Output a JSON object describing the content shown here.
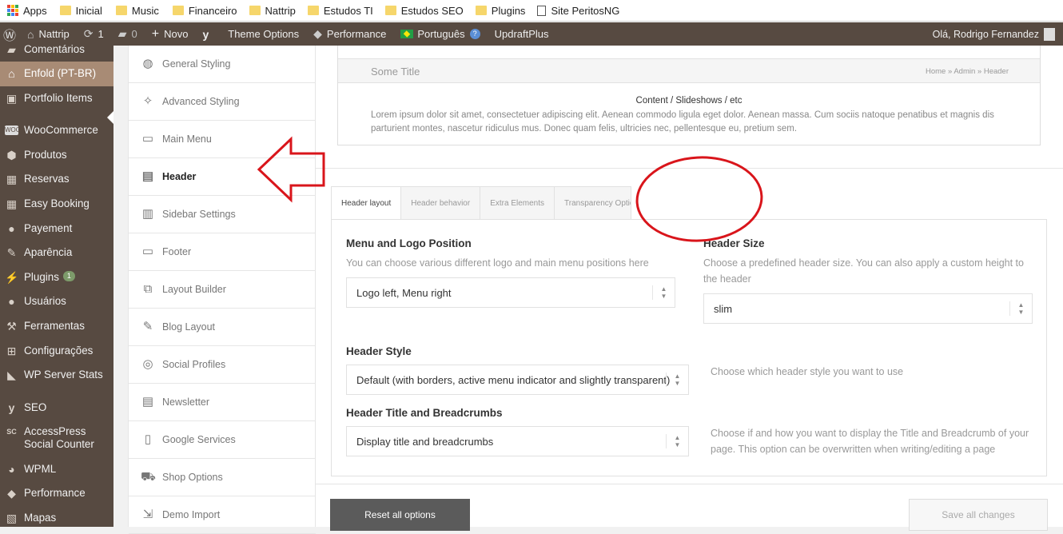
{
  "bookmarks": [
    {
      "label": "Apps",
      "icon": "apps-grid-icon"
    },
    {
      "label": "Inicial",
      "icon": "folder-icon"
    },
    {
      "label": "Music",
      "icon": "folder-icon"
    },
    {
      "label": "Financeiro",
      "icon": "folder-icon"
    },
    {
      "label": "Nattrip",
      "icon": "folder-icon"
    },
    {
      "label": "Estudos TI",
      "icon": "folder-icon"
    },
    {
      "label": "Estudos SEO",
      "icon": "folder-icon"
    },
    {
      "label": "Plugins",
      "icon": "folder-icon"
    },
    {
      "label": "Site PeritosNG",
      "icon": "page-icon"
    }
  ],
  "adminbar": {
    "site_name": "Nattrip",
    "updates_count": "1",
    "comments_count": "0",
    "new_label": "Novo",
    "theme_options": "Theme Options",
    "performance": "Performance",
    "language": "Português",
    "updraft": "UpdraftPlus",
    "howdy": "Olá, Rodrigo Fernandez"
  },
  "sidebar": {
    "items": [
      {
        "label": "Comentários",
        "icon": "comments-icon"
      },
      {
        "label": "Enfold (PT-BR)",
        "icon": "house-icon",
        "active": true
      },
      {
        "label": "Portfolio Items",
        "icon": "portfolio-icon"
      },
      {
        "label": "WooCommerce",
        "icon": "woo-icon"
      },
      {
        "label": "Produtos",
        "icon": "box-icon"
      },
      {
        "label": "Reservas",
        "icon": "calendar-icon"
      },
      {
        "label": "Easy Booking",
        "icon": "calendar-icon"
      },
      {
        "label": "Payement",
        "icon": "coin-icon"
      },
      {
        "label": "Aparência",
        "icon": "brush-icon"
      },
      {
        "label": "Plugins",
        "icon": "plug-icon",
        "badge": "1"
      },
      {
        "label": "Usuários",
        "icon": "user-icon"
      },
      {
        "label": "Ferramentas",
        "icon": "wrench-icon"
      },
      {
        "label": "Configurações",
        "icon": "settings-icon"
      },
      {
        "label": "WP Server Stats",
        "icon": "stats-icon"
      },
      {
        "label": "SEO",
        "icon": "yoast-icon"
      },
      {
        "label": "AccessPress Social Counter",
        "icon": "sc-icon"
      },
      {
        "label": "WPML",
        "icon": "wpml-icon"
      },
      {
        "label": "Performance",
        "icon": "performance-icon"
      },
      {
        "label": "Mapas",
        "icon": "map-icon"
      }
    ]
  },
  "options_nav": {
    "items": [
      {
        "label": "General Styling",
        "icon": "palette-icon"
      },
      {
        "label": "Advanced Styling",
        "icon": "magic-wand-icon"
      },
      {
        "label": "Main Menu",
        "icon": "menu-icon"
      },
      {
        "label": "Header",
        "icon": "header-layout-icon",
        "selected": true
      },
      {
        "label": "Sidebar Settings",
        "icon": "sidebar-layout-icon"
      },
      {
        "label": "Footer",
        "icon": "footer-layout-icon"
      },
      {
        "label": "Layout Builder",
        "icon": "layout-builder-icon"
      },
      {
        "label": "Blog Layout",
        "icon": "blog-icon"
      },
      {
        "label": "Social Profiles",
        "icon": "social-icon"
      },
      {
        "label": "Newsletter",
        "icon": "newsletter-icon"
      },
      {
        "label": "Google Services",
        "icon": "map-book-icon"
      },
      {
        "label": "Shop Options",
        "icon": "cart-icon"
      },
      {
        "label": "Demo Import",
        "icon": "import-icon"
      }
    ]
  },
  "preview": {
    "title": "Some Title",
    "breadcrumb": "Home » Admin » Header",
    "content_title": "Content / Slideshows / etc",
    "lorem": "Lorem ipsum dolor sit amet, consectetuer adipiscing elit. Aenean commodo ligula eget dolor. Aenean massa. Cum sociis natoque penatibus et magnis dis parturient montes, nascetur ridiculus mus. Donec quam felis, ultricies nec, pellentesque eu, pretium sem."
  },
  "tabs": [
    {
      "label": "Header layout",
      "active": true
    },
    {
      "label": "Header behavior"
    },
    {
      "label": "Extra Elements"
    },
    {
      "label": "Transparency Options"
    }
  ],
  "settings": {
    "menu_logo_label": "Menu and Logo Position",
    "menu_logo_desc": "You can choose various different logo and main menu positions here",
    "menu_logo_value": "Logo left, Menu right",
    "header_size_label": "Header Size",
    "header_size_desc": "Choose a predefined header size. You can also apply a custom height to the header",
    "header_size_value": "slim",
    "header_style_label": "Header Style",
    "header_style_value": "Default (with borders, active menu indicator and slightly transparent)",
    "header_style_desc": "Choose which header style you want to use",
    "title_crumbs_label": "Header Title and Breadcrumbs",
    "title_crumbs_value": "Display title and breadcrumbs",
    "title_crumbs_desc": "Choose if and how you want to display the Title and Breadcrumb of your page. This option can be overwritten when writing/editing a page"
  },
  "buttons": {
    "reset": "Reset all options",
    "save": "Save all changes"
  },
  "colors": {
    "admin_bg": "#574a41",
    "active_item": "#a88b75",
    "annotation_red": "#d9151b"
  }
}
